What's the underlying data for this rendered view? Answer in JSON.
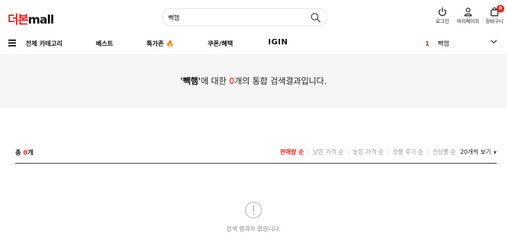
{
  "brand": {
    "logo_part1": "더본",
    "logo_part2": "mall",
    "accent": "#e8221b"
  },
  "search": {
    "value": "빽햄",
    "icon": "search-icon"
  },
  "util": {
    "login": "로그인",
    "mypage": "마이페이지",
    "cart": "장바구니",
    "cart_count": "0"
  },
  "nav": {
    "all_categories": "전체 카테고리",
    "best": "베스트",
    "special": "특가존 🔥",
    "coupon": "쿠폰/혜택",
    "igin": "IGIN"
  },
  "ranking": {
    "rank": "1",
    "term": "빽햄"
  },
  "result": {
    "query": "'빽햄'",
    "text1": "에 대한 ",
    "count": "0",
    "text2": "개의 통합 검색결과입니다."
  },
  "list": {
    "total_prefix": "총 ",
    "total_count": "0",
    "total_suffix": "개",
    "sorts": [
      "판매량 순",
      "낮은 가격 순",
      "높은 가격 순",
      "상품 후기 순",
      "신상품 순"
    ],
    "view": "20개씩 보기"
  },
  "empty": {
    "message": "검색 결과가 없습니다."
  }
}
